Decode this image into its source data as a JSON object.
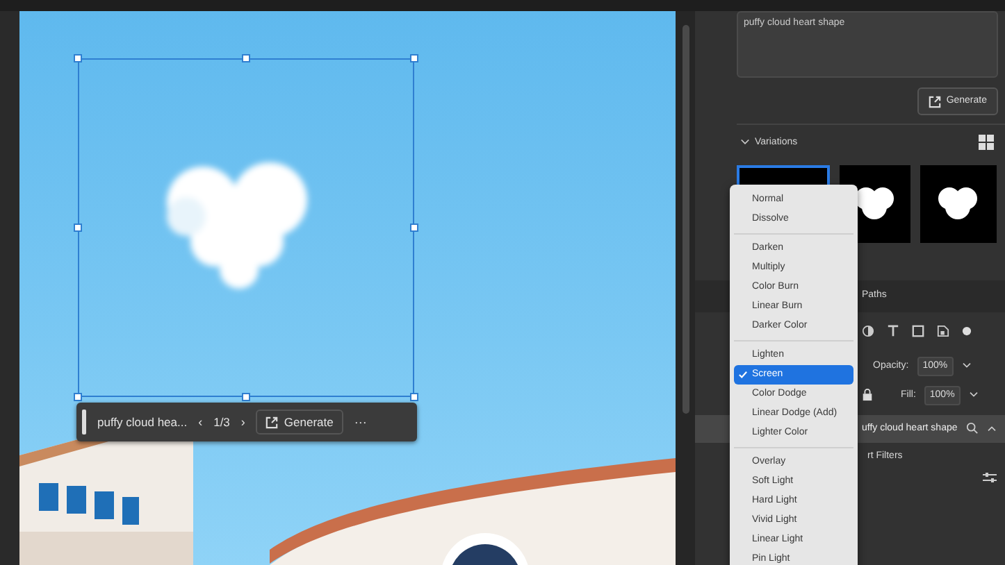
{
  "prompt_bar": {
    "prompt": "puffy cloud hea...",
    "previous": "‹",
    "counter": "1/3",
    "next": "›",
    "generate": "Generate",
    "more": "···"
  },
  "panel": {
    "prompt_field": {
      "value": "puffy cloud heart shape"
    },
    "generate": "Generate",
    "variations": {
      "title": "Variations",
      "expanded": true,
      "thumbnails": [
        {
          "selected": true
        },
        {
          "selected": false
        },
        {
          "selected": false
        }
      ]
    },
    "tabs": [
      {
        "label": "Paths"
      }
    ],
    "opacity": {
      "label": "Opacity:",
      "value": "100%"
    },
    "fill": {
      "label": "Fill:",
      "value": "100%"
    },
    "layer": {
      "name": "uffy cloud heart shape",
      "selected": true
    },
    "smart_filters": "rt Filters"
  },
  "blend_menu": {
    "groups": [
      [
        {
          "label": "Normal",
          "selected": false
        },
        {
          "label": "Dissolve",
          "selected": false
        }
      ],
      [
        {
          "label": "Darken",
          "selected": false
        },
        {
          "label": "Multiply",
          "selected": false
        },
        {
          "label": "Color Burn",
          "selected": false
        },
        {
          "label": "Linear Burn",
          "selected": false
        },
        {
          "label": "Darker Color",
          "selected": false
        }
      ],
      [
        {
          "label": "Lighten",
          "selected": false
        },
        {
          "label": "Screen",
          "selected": true
        },
        {
          "label": "Color Dodge",
          "selected": false
        },
        {
          "label": "Linear Dodge (Add)",
          "selected": false
        },
        {
          "label": "Lighter Color",
          "selected": false
        }
      ],
      [
        {
          "label": "Overlay",
          "selected": false
        },
        {
          "label": "Soft Light",
          "selected": false
        },
        {
          "label": "Hard Light",
          "selected": false
        },
        {
          "label": "Vivid Light",
          "selected": false
        },
        {
          "label": "Linear Light",
          "selected": false
        },
        {
          "label": "Pin Light",
          "selected": false
        }
      ]
    ]
  }
}
